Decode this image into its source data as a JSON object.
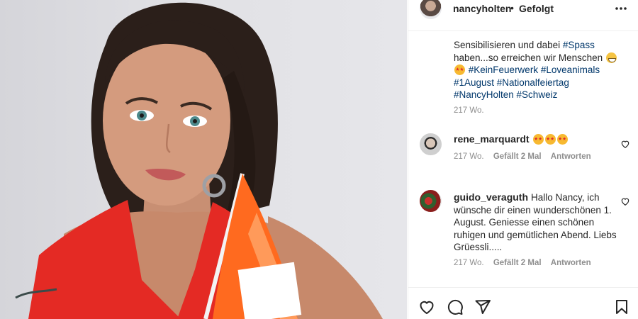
{
  "post": {
    "username": "nancyholten",
    "separator": "•",
    "follow_status": "Gefolgt",
    "caption": {
      "text_1": "Sensibilisieren und dabei ",
      "tag_spass": "#Spass",
      "text_2": " haben...so erreichen wir Menschen ",
      "tags_line": "#KeinFeuerwerk #Loveanimals #1August #Nationalfeiertag #NancyHolten #Schweiz",
      "time": "217 Wo."
    }
  },
  "comments": [
    {
      "username": "rene_marquardt",
      "text": "",
      "time": "217 Wo.",
      "likes": "Gefällt 2 Mal",
      "reply": "Antworten"
    },
    {
      "username": "guido_veraguth",
      "text": "Hallo Nancy, ich wünsche dir einen wunderschönen 1. August. Geniesse einen schönen ruhigen und gemütlichen Abend. Liebs Grüessli.....",
      "time": "217 Wo.",
      "likes": "Gefällt 2 Mal",
      "reply": "Antworten"
    }
  ],
  "icons": {
    "more": "more-options-icon",
    "like": "heart-icon",
    "comment": "comment-icon",
    "share": "paper-plane-icon",
    "save": "bookmark-icon"
  },
  "colors": {
    "hashtag": "#00376b",
    "meta": "#8e8e8e",
    "text": "#262626",
    "dress": "#e42a24",
    "flag": "#ff6a1f"
  }
}
